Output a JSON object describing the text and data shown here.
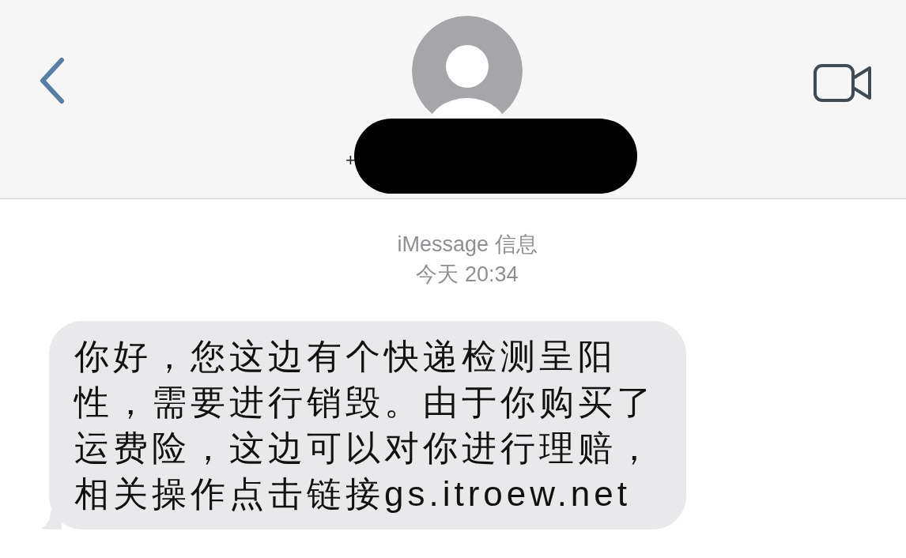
{
  "header": {
    "contact_prefix": "+"
  },
  "service_label": "iMessage 信息",
  "timestamp": "今天 20:34",
  "message": {
    "text": "你好，您这边有个快递检测呈阳性，需要进行销毁。由于你购买了运费险，这边可以对你进行理赔，相关操作点击链接gs.itroew.net"
  }
}
